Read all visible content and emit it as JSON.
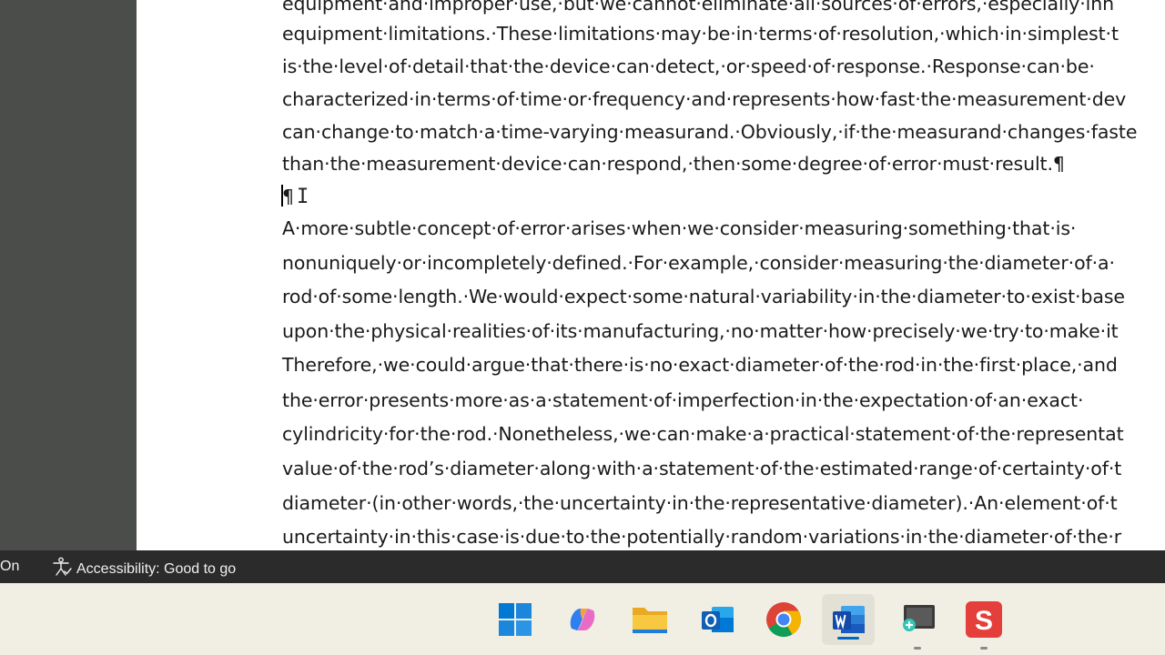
{
  "document": {
    "lines": [
      "equipment·and·improper·use,·but·we·cannot·eliminate·all·sources·of·errors,·especially·inh",
      "equipment·limitations.·These·limitations·may·be·in·terms·of·resolution,·which·in·simplest·t",
      "is·the·level·of·detail·that·the·device·can·detect,·or·speed·of·response.·Response·can·be·",
      "characterized·in·terms·of·time·or·frequency·and·represents·how·fast·the·measurement·dev",
      "can·change·to·match·a·time-varying·measurand.·Obviously,·if·the·measurand·changes·faste",
      "than·the·measurement·device·can·respond,·then·some·degree·of·error·must·result.¶",
      "¶",
      "A·more·subtle·concept·of·error·arises·when·we·consider·measuring·something·that·is·",
      "nonuniquely·or·incompletely·defined.·For·example,·consider·measuring·the·diameter·of·a·",
      "rod·of·some·length.·We·would·expect·some·natural·variability·in·the·diameter·to·exist·base",
      "upon·the·physical·realities·of·its·manufacturing,·no·matter·how·precisely·we·try·to·make·it",
      "Therefore,·we·could·argue·that·there·is·no·exact·diameter·of·the·rod·in·the·first·place,·and",
      "the·error·presents·more·as·a·statement·of·imperfection·in·the·expectation·of·an·exact·",
      "cylindricity·for·the·rod.·Nonetheless,·we·can·make·a·practical·statement·of·the·representat",
      "value·of·the·rod’s·diameter·along·with·a·statement·of·the·estimated·range·of·certainty·of·t",
      "diameter·(in·other·words,·the·uncertainty·in·the·representative·diameter).·An·element·of·t",
      "uncertainty·in·this·case·is·due·to·the·potentially·random·variations·in·the·diameter·of·the·r"
    ]
  },
  "status_bar": {
    "left_text": "On",
    "accessibility": "Accessibility: Good to go"
  },
  "taskbar": {
    "apps": [
      {
        "name": "windows-start",
        "icon": "windows-logo-icon"
      },
      {
        "name": "copilot",
        "icon": "copilot-icon"
      },
      {
        "name": "file-explorer",
        "icon": "folder-icon"
      },
      {
        "name": "outlook",
        "icon": "outlook-icon"
      },
      {
        "name": "chrome",
        "icon": "chrome-icon"
      },
      {
        "name": "word",
        "icon": "word-icon"
      },
      {
        "name": "snipping-tool",
        "icon": "snipping-tool-icon"
      },
      {
        "name": "slides-app",
        "icon": "s-app-icon"
      }
    ],
    "active_app": "word",
    "accent_color": "#0067c0"
  }
}
